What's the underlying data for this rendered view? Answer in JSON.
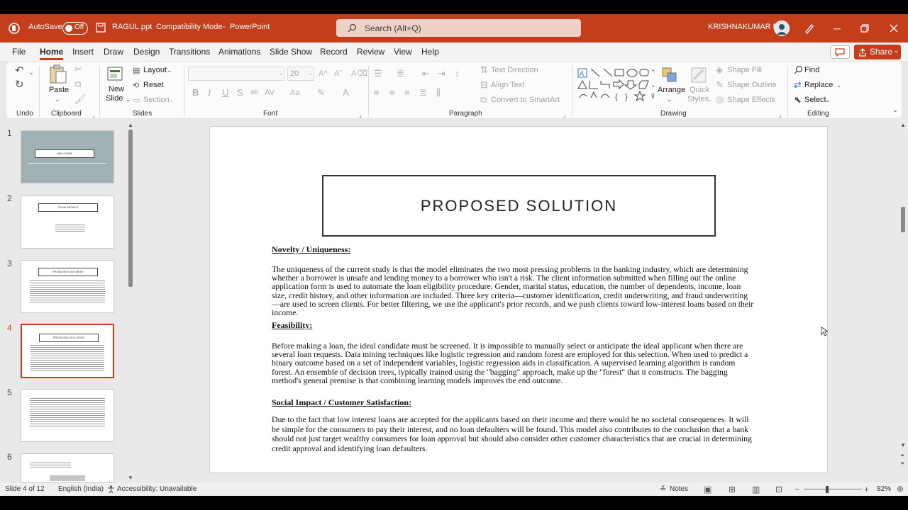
{
  "titlebar": {
    "autosave_label": "AutoSave",
    "autosave_state": "Off",
    "filename": "RAGUL.ppt",
    "mode": "Compatibility Mode",
    "app": "PowerPoint",
    "separator": "-",
    "search_placeholder": "Search (Alt+Q)",
    "user_name": "KRISHNAKUMAR R"
  },
  "menu": {
    "tabs": [
      "File",
      "Home",
      "Insert",
      "Draw",
      "Design",
      "Transitions",
      "Animations",
      "Slide Show",
      "Record",
      "Review",
      "View",
      "Help"
    ],
    "active_tab": "Home",
    "share_label": "Share"
  },
  "ribbon": {
    "undo_group": "Undo",
    "clipboard_group": "Clipboard",
    "paste": "Paste",
    "slides_group": "Slides",
    "new_slide": "New",
    "new_slide2": "Slide",
    "layout": "Layout",
    "reset": "Reset",
    "section": "Section",
    "font_group": "Font",
    "font_size": "20",
    "paragraph_group": "Paragraph",
    "text_direction": "Text Direction",
    "align_text": "Align Text",
    "convert_smartart": "Convert to SmartArt",
    "drawing_group": "Drawing",
    "arrange": "Arrange",
    "quick_styles": "Quick",
    "quick_styles2": "Styles",
    "shape_fill": "Shape Fill",
    "shape_outline": "Shape Outline",
    "shape_effects": "Shape Effects",
    "editing_group": "Editing",
    "find": "Find",
    "replace": "Replace",
    "select": "Select"
  },
  "thumbnails": {
    "numbers": [
      "1",
      "2",
      "3",
      "4",
      "5",
      "6"
    ],
    "t1_title": "WELCOME",
    "t2_title": "TEAM DETAILS",
    "t3_title": "PROBLEM STATEMENT",
    "t4_title": "PROPOSED SOLUTION"
  },
  "slide": {
    "title": "PROPOSED SOLUTION",
    "sections": [
      {
        "heading": "Novelty / Uniqueness:",
        "body": "The uniqueness of the current study is that the model eliminates the two most pressing problems in the banking industry, which are determining whether a borrower is unsafe and lending money to a borrower who isn't a risk. The client information submitted when filling out the online application form is used to automate the loan eligibility procedure. Gender, marital status, education, the number of dependents, income, loan size, credit history, and other information are included. Three key criteria—customer identification, credit underwriting, and fraud underwriting—are used to screen clients. For better filtering, we use the applicant's prior records, and we push clients toward low-interest loans based on their income."
      },
      {
        "heading": "Feasibility:",
        "body": "Before making a loan, the ideal candidate must be screened. It is impossible to manually select or anticipate the ideal applicant when there are several loan requests. Data mining techniques like logistic regression and random forest are employed for this selection. When used to predict a binary outcome based on a set of independent variables, logistic regression aids in classification. A supervised learning algorithm is random forest. An ensemble of decision trees, typically trained using the \"bagging\" approach, make up the \"forest\" that it constructs. The bagging method's general premise is that combining learning models improves the end outcome."
      },
      {
        "heading": "Social Impact / Customer Satisfaction:",
        "body": "Due to the fact that low interest loans are accepted for the applicants based on their income and there would be no societal consequences. It will be simple for the consumers to pay their interest, and no loan defaulters will be found. This model also contributes to the conclusion that a bank should not just target wealthy consumers for loan approval but should also consider other customer characteristics that are crucial in determining credit approval and identifying loan defaulters."
      }
    ]
  },
  "statusbar": {
    "slide_info": "Slide 4 of 12",
    "language": "English (India)",
    "accessibility": "Accessibility: Unavailable",
    "notes": "Notes",
    "zoom": "82%"
  },
  "colors": {
    "brand": "#c43e1c",
    "background": "#e9e9e9"
  }
}
